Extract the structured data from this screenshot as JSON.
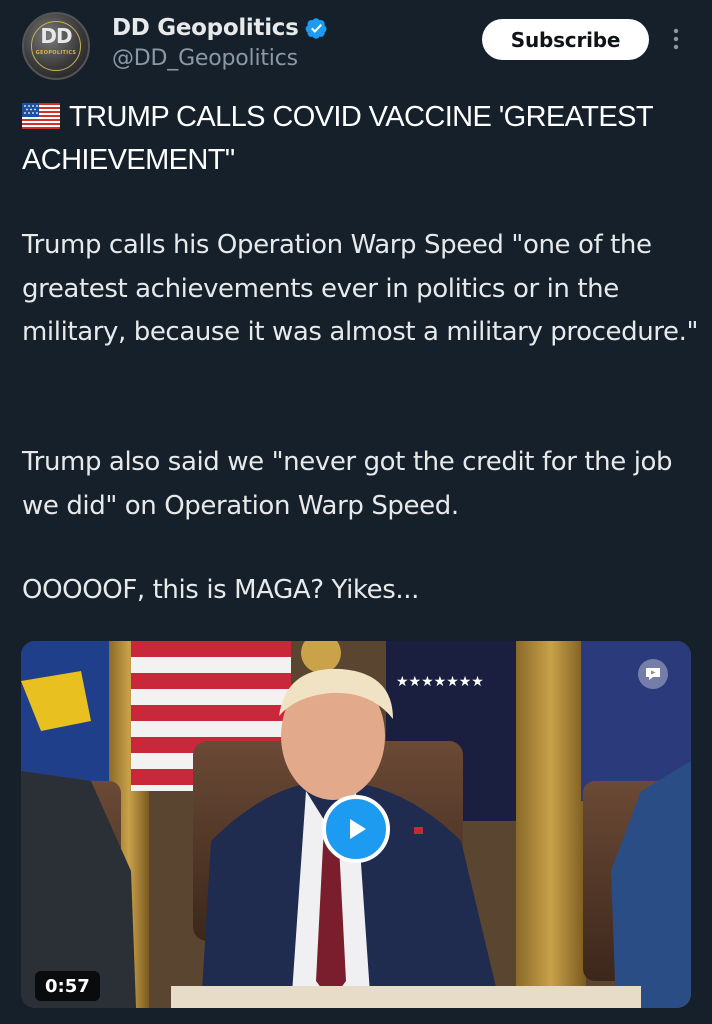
{
  "account": {
    "display_name": "DD Geopolitics",
    "handle": "@DD_Geopolitics",
    "avatar_text": "DD",
    "avatar_subtext": "GEOPOLITICS",
    "verified": true
  },
  "actions": {
    "subscribe_label": "Subscribe"
  },
  "post": {
    "headline": "TRUMP CALLS COVID VACCINE 'GREATEST ACHIEVEMENT\"",
    "paragraphs": [
      "Trump calls his Operation Warp Speed \"one of the greatest achievements ever in politics or in the military, because it was almost a military procedure.\"",
      "Trump also said we \"never got the credit for the job we did\" on Operation Warp Speed.",
      "OOOOOF, this is MAGA? Yikes..."
    ]
  },
  "video": {
    "duration": "0:57"
  },
  "colors": {
    "background": "#15202b",
    "accent": "#1d9bf0",
    "text_primary": "#e7e9ea",
    "text_secondary": "#8b98a5"
  },
  "icons": [
    "verified-badge-icon",
    "more-options-icon",
    "us-flag-icon",
    "play-icon",
    "media-overlay-icon"
  ]
}
